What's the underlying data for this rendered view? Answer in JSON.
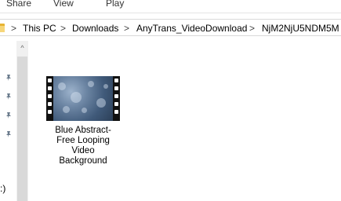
{
  "ribbon": {
    "tabs": [
      "Share",
      "View",
      "Play"
    ]
  },
  "address": {
    "crumbs": [
      "This PC",
      "Downloads",
      "AnyTrans_VideoDownload",
      "NjM2NjU5NDM5M"
    ],
    "separator": ">"
  },
  "navigation": {
    "scroll_up": "^",
    "drive_label_fragment": ":)",
    "pins": [
      "pin-icon",
      "pin-icon",
      "pin-icon",
      "pin-icon"
    ]
  },
  "files": [
    {
      "name_lines": [
        "Blue Abstract-",
        "Free Looping",
        "Video",
        "Background"
      ],
      "icon": "video-thumbnail-icon"
    }
  ],
  "colors": {
    "folder": "#e8b432",
    "scroll_track": "#f0f0f0",
    "scroll_thumb": "#d9d9d9"
  }
}
